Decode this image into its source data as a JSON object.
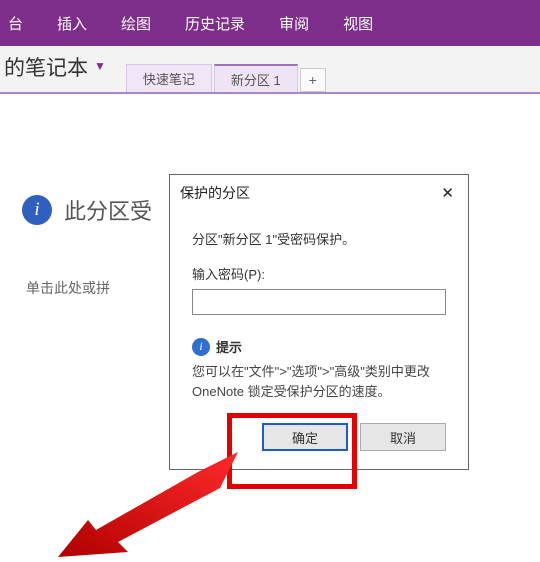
{
  "ribbon": {
    "tabs": [
      "台",
      "插入",
      "绘图",
      "历史记录",
      "审阅",
      "视图"
    ]
  },
  "notebook": {
    "name_suffix": "的笔记本",
    "dropdown_glyph": "▼"
  },
  "section_tabs": {
    "inactive": "快速笔记",
    "active": "新分区 1",
    "add_glyph": "+"
  },
  "main": {
    "heading": "此分区受",
    "subtext": "单击此处或拼"
  },
  "dialog": {
    "title": "保护的分区",
    "close_glyph": "✕",
    "message": "分区\"新分区 1\"受密码保护。",
    "password_label": "输入密码(P):",
    "password_value": "",
    "hint_title": "提示",
    "hint_text": "您可以在\"文件\">\"选项\">\"高级\"类别中更改 OneNote 锁定受保护分区的速度。",
    "ok_label": "确定",
    "cancel_label": "取消"
  }
}
